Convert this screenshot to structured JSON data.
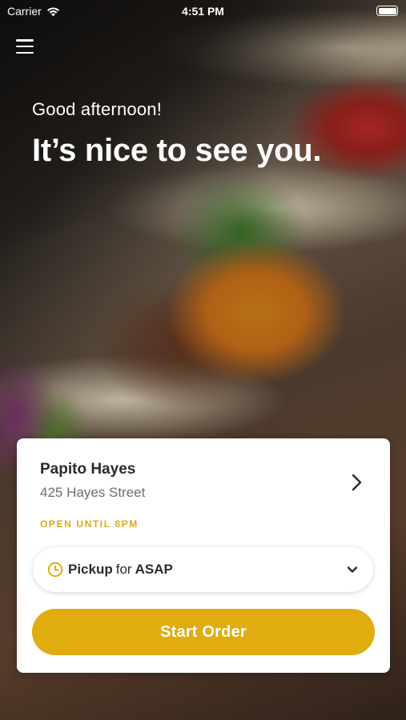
{
  "status_bar": {
    "carrier": "Carrier",
    "time": "4:51 PM"
  },
  "hero": {
    "greeting": "Good afternoon!",
    "headline": "It’s nice to see you."
  },
  "location_card": {
    "name": "Papito Hayes",
    "address": "425 Hayes Street",
    "hours": "OPEN UNTIL 8PM",
    "pickup": {
      "mode": "Pickup",
      "connector": "for",
      "time": "ASAP"
    },
    "start_order_label": "Start Order"
  },
  "colors": {
    "accent": "#e1ac0f",
    "hours_text": "#dcaa1a"
  },
  "icons": [
    "wifi-icon",
    "battery-icon",
    "menu-icon",
    "chevron-right-icon",
    "clock-icon",
    "chevron-down-icon"
  ]
}
